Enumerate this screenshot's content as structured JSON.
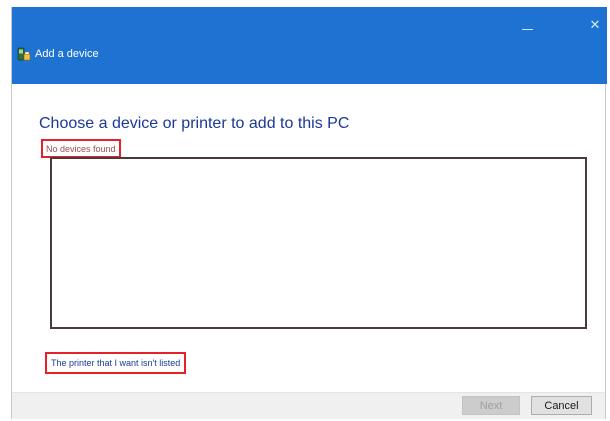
{
  "window": {
    "title": "Add a device",
    "minimize_icon": "minimize-icon",
    "close_glyph": "✕",
    "close_icon": "close-icon",
    "app_icon": "devices-printers-icon"
  },
  "main": {
    "heading": "Choose a device or printer to add to this PC",
    "status_text": "No devices found",
    "device_list": [],
    "printer_link": "The printer that I want isn't listed"
  },
  "footer": {
    "next_label": "Next",
    "next_enabled": false,
    "cancel_label": "Cancel"
  },
  "colors": {
    "titlebar": "#1e73d2",
    "heading": "#1b3898",
    "highlight_border": "#e8202a",
    "link": "#1c3a99"
  }
}
